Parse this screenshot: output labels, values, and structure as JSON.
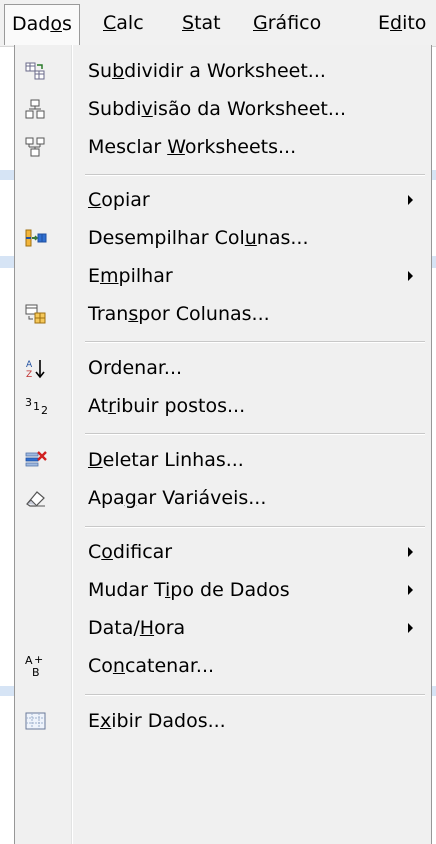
{
  "menubar": [
    {
      "pre": "Dad",
      "u": "o",
      "post": "s"
    },
    {
      "pre": "",
      "u": "C",
      "post": "alc"
    },
    {
      "pre": "",
      "u": "S",
      "post": "tat"
    },
    {
      "pre": "",
      "u": "G",
      "post": "ráfico"
    },
    {
      "pre": "E",
      "u": "d",
      "post": "ito"
    }
  ],
  "menu": [
    {
      "icon": "subdivide-worksheet-icon",
      "pre": "Su",
      "u": "b",
      "post": "dividir a Worksheet..."
    },
    {
      "icon": "subdivision-worksheet-icon",
      "pre": "Subdi",
      "u": "v",
      "post": "isão da Worksheet..."
    },
    {
      "icon": "merge-worksheets-icon",
      "pre": "Mesclar ",
      "u": "W",
      "post": "orksheets..."
    },
    {
      "sep": true
    },
    {
      "icon": "",
      "pre": "",
      "u": "C",
      "post": "opiar",
      "submenu": true
    },
    {
      "icon": "unstack-columns-icon",
      "pre": "Desempilhar Col",
      "u": "u",
      "post": "nas..."
    },
    {
      "icon": "",
      "pre": "E",
      "u": "m",
      "post": "pilhar",
      "submenu": true
    },
    {
      "icon": "transpose-columns-icon",
      "pre": "Tran",
      "u": "s",
      "post": "por Colunas..."
    },
    {
      "sep": true
    },
    {
      "icon": "sort-az-icon",
      "pre": "Ordenar...",
      "u": "",
      "post": ""
    },
    {
      "icon": "rank-icon",
      "pre": "At",
      "u": "r",
      "post": "ibuir postos..."
    },
    {
      "sep": true
    },
    {
      "icon": "delete-rows-icon",
      "pre": "",
      "u": "D",
      "post": "eletar Linhas..."
    },
    {
      "icon": "erase-variables-icon",
      "pre": "Apa",
      "u": "g",
      "post": "ar Variáveis..."
    },
    {
      "sep": true
    },
    {
      "icon": "",
      "pre": "C",
      "u": "o",
      "post": "dificar",
      "submenu": true
    },
    {
      "icon": "",
      "pre": "Mudar T",
      "u": "i",
      "post": "po de Dados",
      "submenu": true
    },
    {
      "icon": "",
      "pre": "Data/",
      "u": "H",
      "post": "ora",
      "submenu": true
    },
    {
      "icon": "concatenate-icon",
      "pre": "Co",
      "u": "n",
      "post": "catenar..."
    },
    {
      "sep": true
    },
    {
      "icon": "display-data-icon",
      "pre": "E",
      "u": "x",
      "post": "ibir Dados..."
    }
  ],
  "colors": {
    "menu_bg": "#f0f0f0",
    "menubar_bg": "#f1f1f1",
    "separator": "#c8c8c8"
  }
}
